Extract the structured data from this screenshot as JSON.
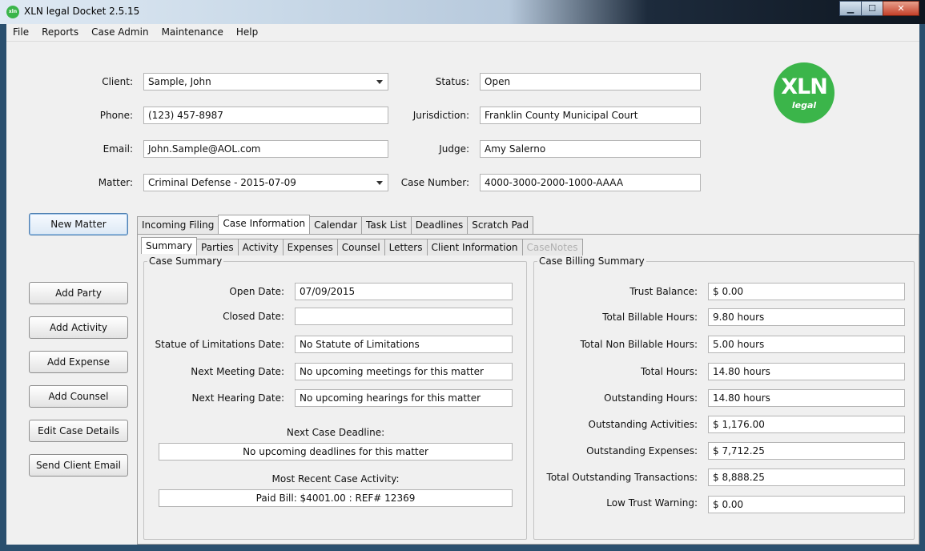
{
  "window": {
    "title": "XLN legal Docket 2.5.15",
    "icon_text": "xln"
  },
  "menu": [
    "File",
    "Reports",
    "Case Admin",
    "Maintenance",
    "Help"
  ],
  "header": {
    "client_label": "Client:",
    "client_value": "Sample, John",
    "phone_label": "Phone:",
    "phone_value": "(123) 457-8987",
    "email_label": "Email:",
    "email_value": "John.Sample@AOL.com",
    "matter_label": "Matter:",
    "matter_value": "Criminal Defense - 2015-07-09",
    "status_label": "Status:",
    "status_value": "Open",
    "jurisdiction_label": "Jurisdiction:",
    "jurisdiction_value": "Franklin County Municipal Court",
    "judge_label": "Judge:",
    "judge_value": "Amy Salerno",
    "case_number_label": "Case Number:",
    "case_number_value": "4000-3000-2000-1000-AAAA"
  },
  "logo": {
    "big": "XLN",
    "small": "legal"
  },
  "buttons": {
    "new_matter": "New Matter",
    "add_party": "Add Party",
    "add_activity": "Add Activity",
    "add_expense": "Add Expense",
    "add_counsel": "Add Counsel",
    "edit_case_details": "Edit Case Details",
    "send_client_email": "Send Client Email"
  },
  "tabs": {
    "incoming_filing": "Incoming Filing",
    "case_information": "Case Information",
    "calendar": "Calendar",
    "task_list": "Task List",
    "deadlines": "Deadlines",
    "scratch_pad": "Scratch Pad",
    "active": "Case Information"
  },
  "subtabs": {
    "summary": "Summary",
    "parties": "Parties",
    "activity": "Activity",
    "expenses": "Expenses",
    "counsel": "Counsel",
    "letters": "Letters",
    "client_information": "Client Information",
    "case_notes": "CaseNotes",
    "active": "Summary"
  },
  "case_summary": {
    "title": "Case Summary",
    "open_date_label": "Open Date:",
    "open_date": "07/09/2015",
    "closed_date_label": "Closed Date:",
    "closed_date": "",
    "sol_label": "Statue of Limitations Date:",
    "sol": "No Statute of Limitations",
    "next_meeting_label": "Next Meeting Date:",
    "next_meeting": "No upcoming meetings for this matter",
    "next_hearing_label": "Next Hearing Date:",
    "next_hearing": "No upcoming hearings for this matter",
    "next_deadline_label": "Next Case Deadline:",
    "next_deadline": "No upcoming deadlines for this matter",
    "recent_activity_label": "Most Recent Case Activity:",
    "recent_activity": "Paid Bill: $4001.00  :  REF# 12369"
  },
  "billing": {
    "title": "Case Billing Summary",
    "trust_balance_label": "Trust Balance:",
    "trust_balance": "$ 0.00",
    "billable_label": "Total Billable Hours:",
    "billable": "9.80 hours",
    "non_billable_label": "Total Non Billable Hours:",
    "non_billable": "5.00 hours",
    "total_hours_label": "Total Hours:",
    "total_hours": "14.80 hours",
    "outstanding_hours_label": "Outstanding Hours:",
    "outstanding_hours": "14.80 hours",
    "outstanding_activities_label": "Outstanding Activities:",
    "outstanding_activities": "$ 1,176.00",
    "outstanding_expenses_label": "Outstanding Expenses:",
    "outstanding_expenses": "$ 7,712.25",
    "total_outstanding_label": "Total Outstanding Transactions:",
    "total_outstanding": "$ 8,888.25",
    "low_trust_label": "Low Trust Warning:",
    "low_trust": "$ 0.00"
  }
}
